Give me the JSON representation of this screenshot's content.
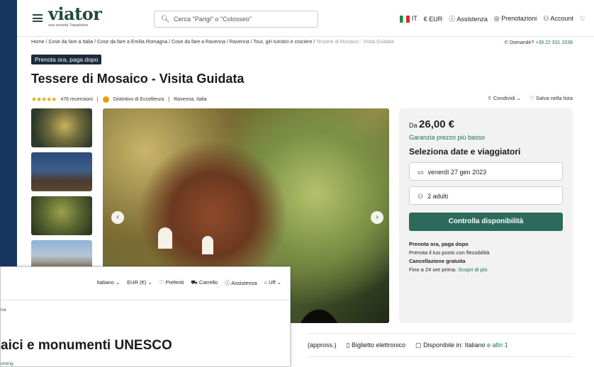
{
  "header": {
    "logo": "viator",
    "logo_sub": "una società Tripadvisor",
    "search_placeholder": "Cerca \"Parigi\" o \"Colosseo\"",
    "lang": "IT",
    "currency": "€ EUR",
    "help": "Assistenza",
    "bookings": "Prenotazioni",
    "account": "Account"
  },
  "breadcrumb": {
    "items": "Home / Cose da fare a Italia / Cose da fare a Emilia Romagna / Cose da fare a Ravenna / Ravenna / Tour, giri turistici e crociere /",
    "current": " Tessere di Mosaico - Visita Guidata"
  },
  "phone": {
    "label": "Domande?",
    "number": "+39 22 331 2036"
  },
  "badge": "Prenota ora, paga dopo",
  "title": "Tessere di Mosaico - Visita Guidata",
  "meta": {
    "reviews": "476 recensioni",
    "excellence": "Distintivo di Eccellenza",
    "location": "Ravenna, Italia",
    "stars": "★★★★★"
  },
  "actions": {
    "share": "Condividi",
    "save": "Salva nella lista"
  },
  "booking": {
    "from": "Da",
    "price": "26,00 €",
    "guarantee": "Garanzia prezzo più basso",
    "heading": "Seleziona date e viaggiatori",
    "date": "venerdì 27 gen 2023",
    "travelers": "2 adulti",
    "cta": "Controlla disponibilità",
    "pay_title": "Prenota ora, paga dopo",
    "pay_text": "Prenota il tuo posto con flessibilità",
    "cancel_title": "Cancellazione gratuita",
    "cancel_text": "Fino a 24 ore prima.",
    "cancel_link": "Scopri di più"
  },
  "features": {
    "duration": "(appross.)",
    "ticket": "Biglietto elettronico",
    "lang": "Disponibile in: Italiano",
    "more": "e altri 1"
  },
  "second": {
    "lang": "Italiano",
    "currency": "EUR (€)",
    "fav": "Preferiti",
    "cart": "Carrello",
    "help": "Assistenza",
    "user": "Uff",
    "crumb": "na",
    "title": "aici e monumenti UNESCO",
    "sub": "oming"
  }
}
